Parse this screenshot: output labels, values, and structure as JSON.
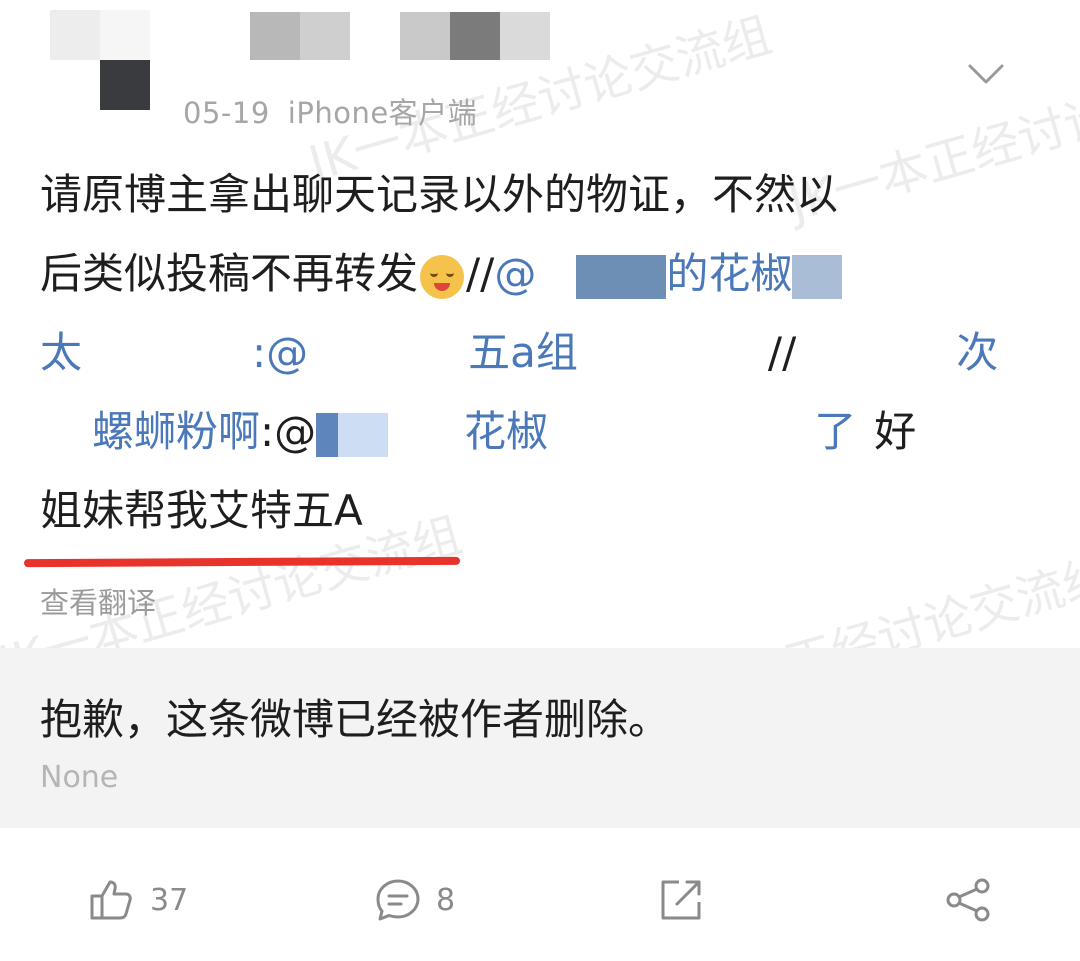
{
  "post": {
    "date": "05-19",
    "source": "iPhone客户端",
    "lines": {
      "l1": "请原博主拿出聊天记录以外的物证，不然以",
      "l2_text": "后类似投稿不再转发",
      "l2_sep": "//",
      "l2_at": "@",
      "l2_name": "的花椒",
      "l3_a": "太",
      "l3_b": ":@",
      "l3_c": "五a组",
      "l3_d": "//",
      "l3_e": "次",
      "l4_a": "螺蛳粉啊",
      "l4_b": ":@",
      "l4_c": "花椒",
      "l4_d": "了",
      "l4_e": "好",
      "l5": "姐妹帮我艾特五A"
    },
    "translate": "查看翻译"
  },
  "deleted": {
    "message": "抱歉，这条微博已经被作者删除。",
    "note": "None"
  },
  "actions": {
    "like_count": "37",
    "comment_count": "8"
  },
  "watermark": {
    "text": "JK一本正经讨论交流组"
  },
  "colors": {
    "link": "#4a78b8",
    "underline": "#e8322c",
    "deleted_bg": "#f3f3f3"
  }
}
